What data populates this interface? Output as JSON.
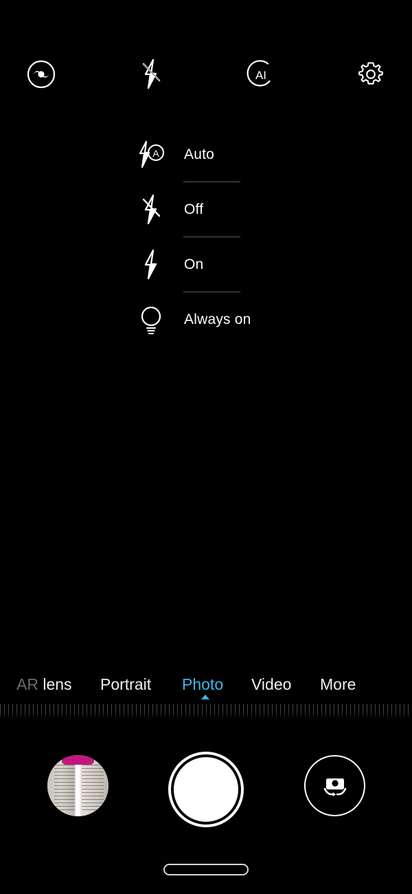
{
  "app": {
    "name": "Camera",
    "background_color": "#000000",
    "accent_color": "#3fb6e8"
  },
  "top_bar": {
    "items": [
      {
        "id": "beauty",
        "icon": "beauty-eye-icon",
        "label": "Beauty"
      },
      {
        "id": "flash",
        "icon": "flash-off-icon",
        "label": "Flash"
      },
      {
        "id": "ai",
        "icon": "ai-icon",
        "label": "AI"
      },
      {
        "id": "settings",
        "icon": "gear-icon",
        "label": "Settings"
      }
    ]
  },
  "flash_menu": {
    "visible": true,
    "selected": "Off",
    "options": [
      {
        "label": "Auto",
        "icon": "flash-auto-icon"
      },
      {
        "label": "Off",
        "icon": "flash-off-icon"
      },
      {
        "label": "On",
        "icon": "flash-on-icon"
      },
      {
        "label": "Always on",
        "icon": "torch-bulb-icon"
      }
    ]
  },
  "mode_selector": {
    "active": "Photo",
    "modes": [
      {
        "label": "AR lens",
        "state": "partially-scrolled"
      },
      {
        "label": "Portrait",
        "state": "normal"
      },
      {
        "label": "Photo",
        "state": "active"
      },
      {
        "label": "Video",
        "state": "normal"
      },
      {
        "label": "More",
        "state": "normal"
      }
    ],
    "ar_lens_prefix": "AR ",
    "ar_lens_suffix": "lens"
  },
  "zoom_ruler": {
    "visible": true,
    "description": "fine tick marks"
  },
  "bottom_bar": {
    "gallery_thumbnail": {
      "label": "Gallery",
      "icon": "gallery-thumbnail"
    },
    "shutter": {
      "label": "Shutter",
      "icon": "shutter-button"
    },
    "camera_switch": {
      "label": "Switch camera",
      "icon": "camera-flip-icon"
    }
  },
  "system": {
    "home_indicator": "home-indicator"
  }
}
